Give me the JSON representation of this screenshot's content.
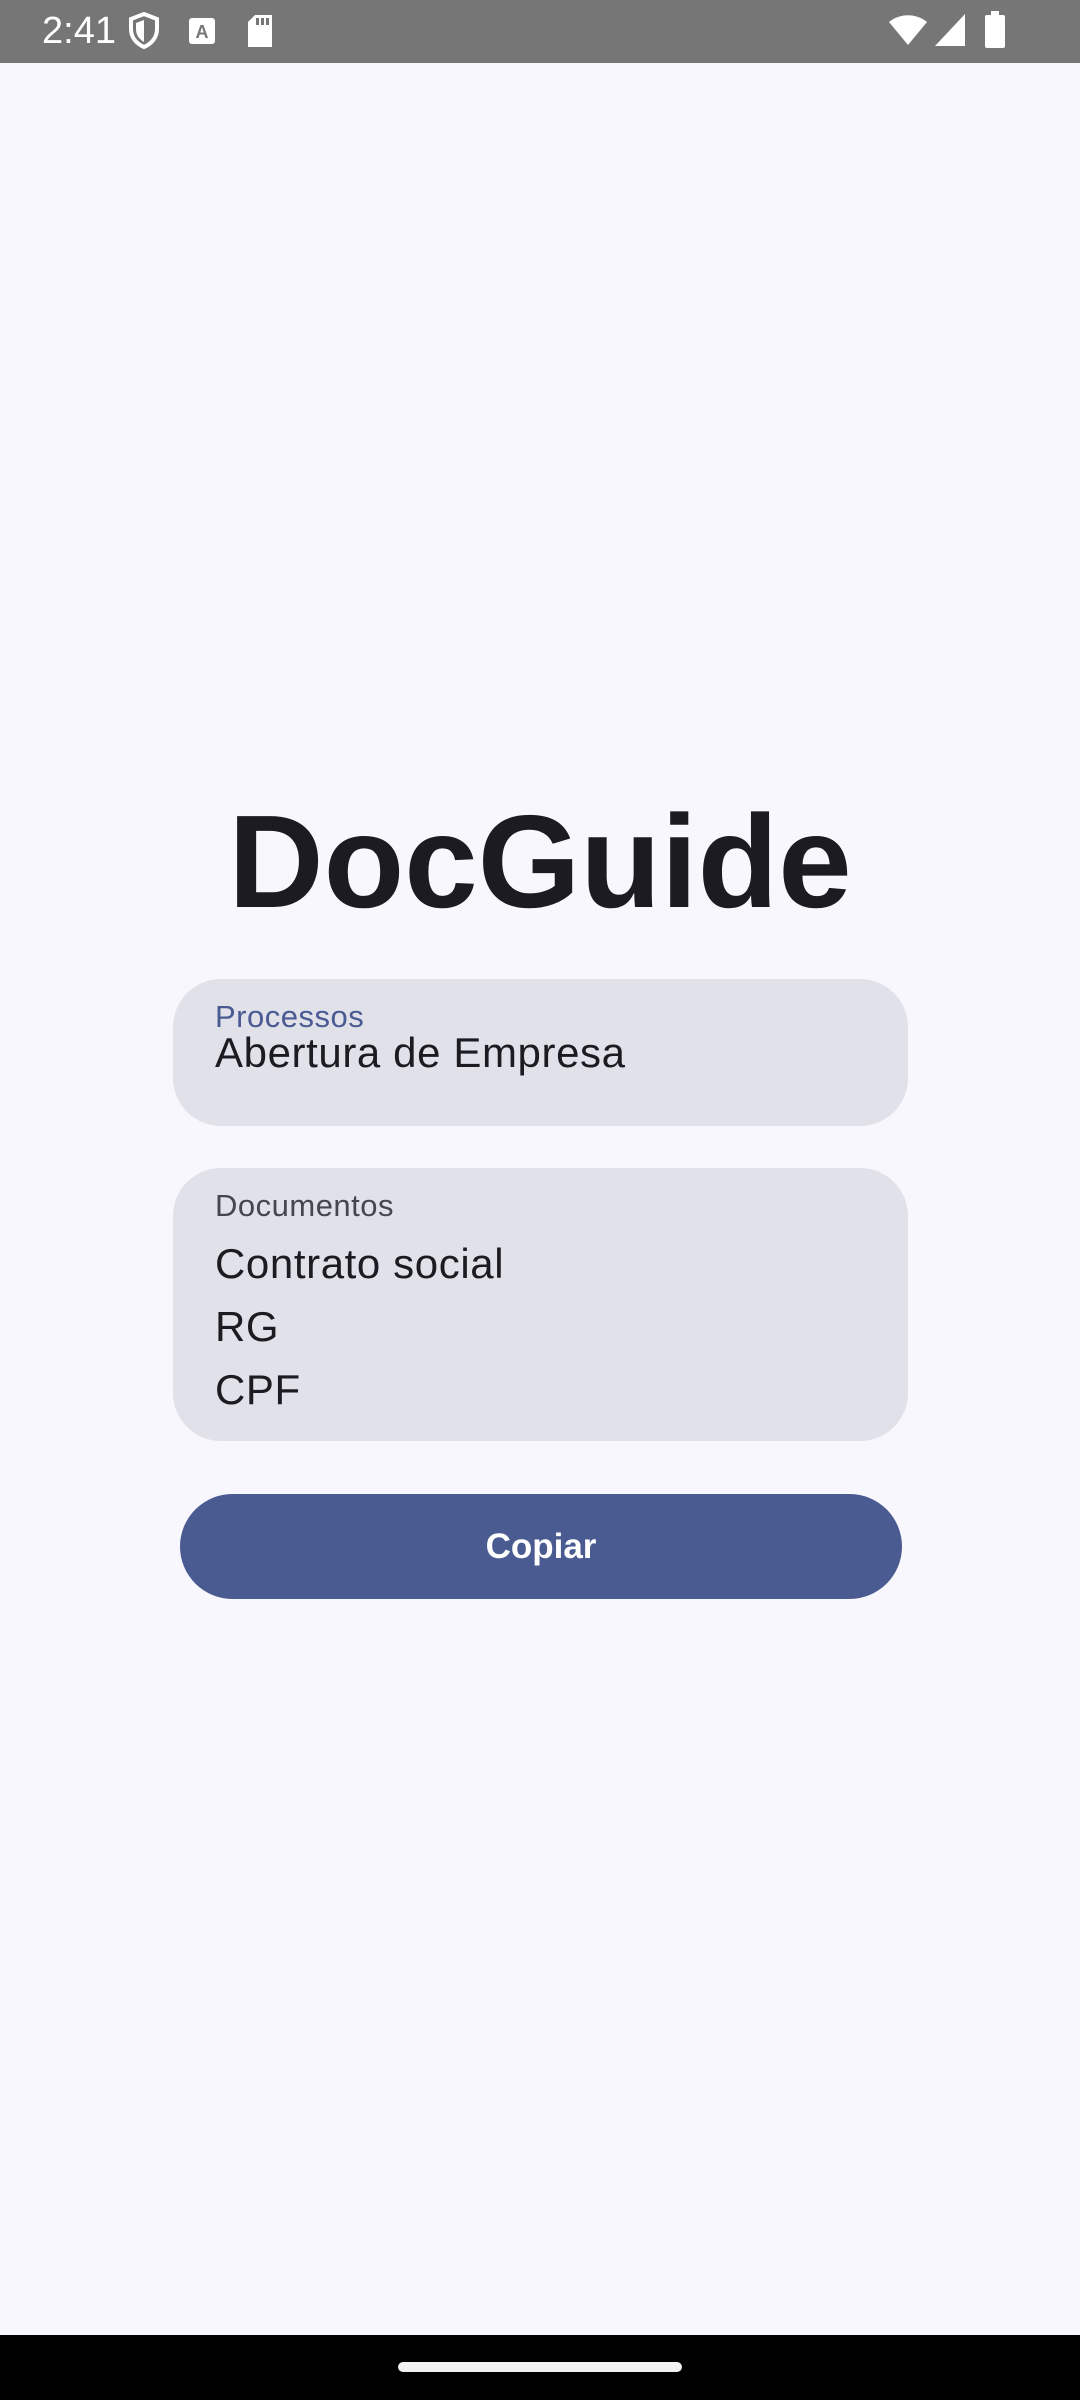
{
  "status_bar": {
    "time": "2:41",
    "icons_left": [
      "shield-icon",
      "text-a-icon",
      "sd-card-icon"
    ],
    "icons_right": [
      "wifi-icon",
      "signal-icon",
      "battery-icon"
    ]
  },
  "app": {
    "title": "DocGuide"
  },
  "processos_field": {
    "label": "Processos",
    "value": "Abertura de Empresa"
  },
  "documentos_field": {
    "label": "Documentos",
    "items": [
      "Contrato social",
      "RG",
      "CPF"
    ]
  },
  "copy_button": {
    "label": "Copiar"
  },
  "colors": {
    "background": "#f8f7fd",
    "field_background": "#e1e1ea",
    "accent": "#4a5b91",
    "status_bar": "#767676"
  }
}
